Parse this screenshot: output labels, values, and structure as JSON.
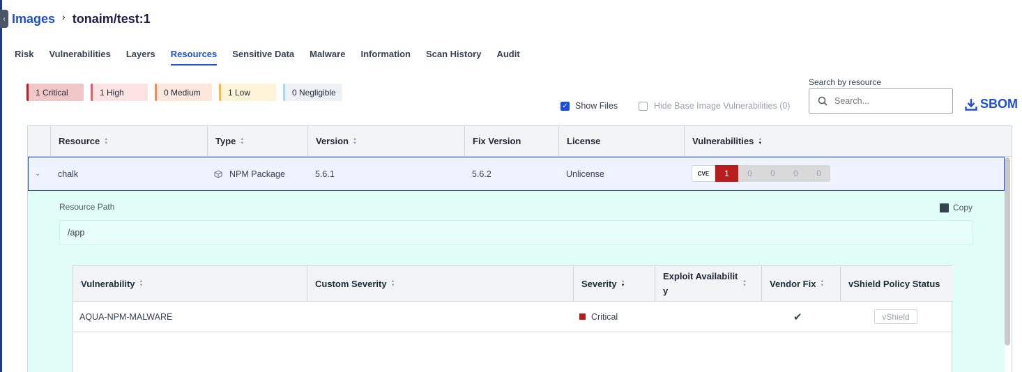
{
  "breadcrumb": {
    "parent": "Images",
    "current": "tonaim/test:1"
  },
  "tabs": [
    {
      "label": "Risk"
    },
    {
      "label": "Vulnerabilities"
    },
    {
      "label": "Layers"
    },
    {
      "label": "Resources",
      "active": true
    },
    {
      "label": "Sensitive Data"
    },
    {
      "label": "Malware"
    },
    {
      "label": "Information"
    },
    {
      "label": "Scan History"
    },
    {
      "label": "Audit"
    }
  ],
  "severity_chips": {
    "critical": "1 Critical",
    "high": "1 High",
    "medium": "0 Medium",
    "low": "1 Low",
    "negligible": "0 Negligible"
  },
  "filters": {
    "show_files": "Show Files",
    "show_files_checked": true,
    "hide_base": "Hide Base Image Vulnerabilities (0)",
    "hide_base_checked": false
  },
  "search": {
    "label": "Search by resource",
    "placeholder": "Search..."
  },
  "sbom_label": "SBOM",
  "table": {
    "headers": [
      "Resource",
      "Type",
      "Version",
      "Fix Version",
      "License",
      "Vulnerabilities"
    ],
    "row": {
      "resource": "chalk",
      "type": "NPM Package",
      "version": "5.6.1",
      "fix_version": "5.6.2",
      "license": "Unlicense",
      "vuln_counts": [
        "1",
        "0",
        "0",
        "0",
        "0"
      ]
    }
  },
  "details": {
    "resource_path_label": "Resource Path",
    "copy_label": "Copy",
    "resource_path": "/app",
    "vuln_table": {
      "headers": [
        "Vulnerability",
        "Custom Severity",
        "Severity",
        "Exploit Availabilit y",
        "Vendor Fix",
        "vShield Policy Status"
      ],
      "row": {
        "vulnerability": "AQUA-NPM-MALWARE",
        "custom_severity": "",
        "severity": "Critical",
        "vendor_fix": "✔",
        "vshield": "vShield"
      }
    }
  },
  "colors": {
    "accent": "#1d4ed8",
    "critical": "#b91c1c",
    "expanded_bg": "#e0fdf8"
  }
}
